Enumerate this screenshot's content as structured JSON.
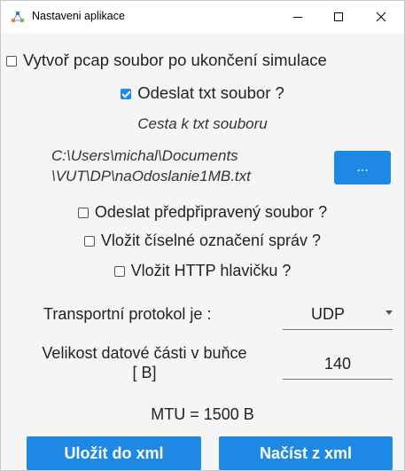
{
  "window": {
    "title": "Nastaveni aplikace",
    "app_icon": "network-nodes-icon"
  },
  "options": {
    "pcap_label": "Vytvoř pcap soubor po ukončení simulace",
    "pcap_checked": false,
    "send_txt_label": "Odeslat txt soubor ?",
    "send_txt_checked": true,
    "path_caption": "Cesta k txt souboru",
    "path_line1": "C:\\Users\\michal\\Documents",
    "path_line2": "\\VUT\\DP\\naOdoslanie1MB.txt",
    "browse_label": "...",
    "prepared_label": "Odeslat předpřipravený soubor ?",
    "prepared_checked": false,
    "numbering_label": "Vložit číselné označení správ ?",
    "numbering_checked": false,
    "http_label": "Vložit HTTP hlavičku ?",
    "http_checked": false
  },
  "transport": {
    "label": "Transportní protokol je :",
    "value": "UDP"
  },
  "size": {
    "label_line1": "Velikost datové části v buňce",
    "label_line2": "[ B]",
    "value": "140"
  },
  "mtu": "MTU = 1500 B",
  "buttons": {
    "save": "Uložit do xml",
    "load": "Načíst z xml"
  },
  "colors": {
    "accent": "#1e88e5",
    "background": "#f5f5f5"
  }
}
